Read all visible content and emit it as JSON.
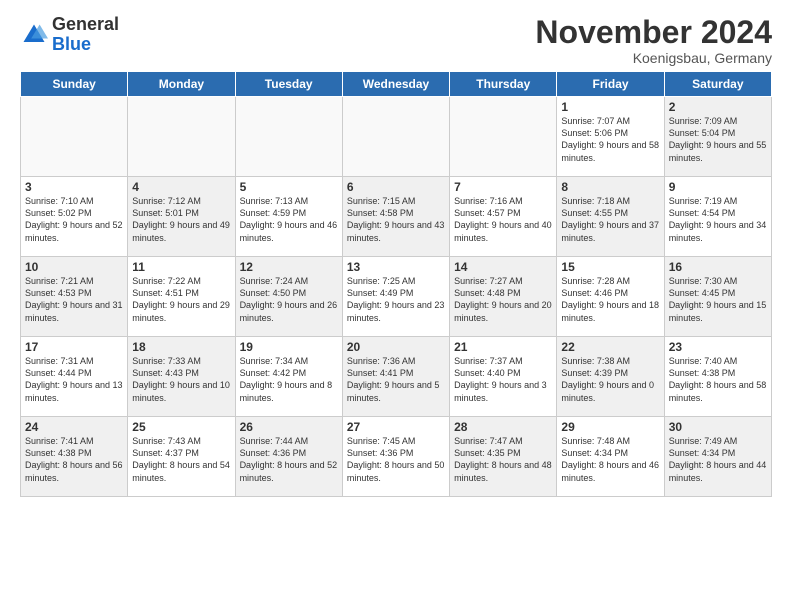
{
  "logo": {
    "general": "General",
    "blue": "Blue"
  },
  "header": {
    "title": "November 2024",
    "subtitle": "Koenigsbau, Germany"
  },
  "weekdays": [
    "Sunday",
    "Monday",
    "Tuesday",
    "Wednesday",
    "Thursday",
    "Friday",
    "Saturday"
  ],
  "weeks": [
    [
      {
        "day": "",
        "info": "",
        "empty": true
      },
      {
        "day": "",
        "info": "",
        "empty": true
      },
      {
        "day": "",
        "info": "",
        "empty": true
      },
      {
        "day": "",
        "info": "",
        "empty": true
      },
      {
        "day": "",
        "info": "",
        "empty": true
      },
      {
        "day": "1",
        "info": "Sunrise: 7:07 AM\nSunset: 5:06 PM\nDaylight: 9 hours\nand 58 minutes.",
        "empty": false
      },
      {
        "day": "2",
        "info": "Sunrise: 7:09 AM\nSunset: 5:04 PM\nDaylight: 9 hours\nand 55 minutes.",
        "empty": false
      }
    ],
    [
      {
        "day": "3",
        "info": "Sunrise: 7:10 AM\nSunset: 5:02 PM\nDaylight: 9 hours\nand 52 minutes.",
        "empty": false
      },
      {
        "day": "4",
        "info": "Sunrise: 7:12 AM\nSunset: 5:01 PM\nDaylight: 9 hours\nand 49 minutes.",
        "empty": false
      },
      {
        "day": "5",
        "info": "Sunrise: 7:13 AM\nSunset: 4:59 PM\nDaylight: 9 hours\nand 46 minutes.",
        "empty": false
      },
      {
        "day": "6",
        "info": "Sunrise: 7:15 AM\nSunset: 4:58 PM\nDaylight: 9 hours\nand 43 minutes.",
        "empty": false
      },
      {
        "day": "7",
        "info": "Sunrise: 7:16 AM\nSunset: 4:57 PM\nDaylight: 9 hours\nand 40 minutes.",
        "empty": false
      },
      {
        "day": "8",
        "info": "Sunrise: 7:18 AM\nSunset: 4:55 PM\nDaylight: 9 hours\nand 37 minutes.",
        "empty": false
      },
      {
        "day": "9",
        "info": "Sunrise: 7:19 AM\nSunset: 4:54 PM\nDaylight: 9 hours\nand 34 minutes.",
        "empty": false
      }
    ],
    [
      {
        "day": "10",
        "info": "Sunrise: 7:21 AM\nSunset: 4:53 PM\nDaylight: 9 hours\nand 31 minutes.",
        "empty": false
      },
      {
        "day": "11",
        "info": "Sunrise: 7:22 AM\nSunset: 4:51 PM\nDaylight: 9 hours\nand 29 minutes.",
        "empty": false
      },
      {
        "day": "12",
        "info": "Sunrise: 7:24 AM\nSunset: 4:50 PM\nDaylight: 9 hours\nand 26 minutes.",
        "empty": false
      },
      {
        "day": "13",
        "info": "Sunrise: 7:25 AM\nSunset: 4:49 PM\nDaylight: 9 hours\nand 23 minutes.",
        "empty": false
      },
      {
        "day": "14",
        "info": "Sunrise: 7:27 AM\nSunset: 4:48 PM\nDaylight: 9 hours\nand 20 minutes.",
        "empty": false
      },
      {
        "day": "15",
        "info": "Sunrise: 7:28 AM\nSunset: 4:46 PM\nDaylight: 9 hours\nand 18 minutes.",
        "empty": false
      },
      {
        "day": "16",
        "info": "Sunrise: 7:30 AM\nSunset: 4:45 PM\nDaylight: 9 hours\nand 15 minutes.",
        "empty": false
      }
    ],
    [
      {
        "day": "17",
        "info": "Sunrise: 7:31 AM\nSunset: 4:44 PM\nDaylight: 9 hours\nand 13 minutes.",
        "empty": false
      },
      {
        "day": "18",
        "info": "Sunrise: 7:33 AM\nSunset: 4:43 PM\nDaylight: 9 hours\nand 10 minutes.",
        "empty": false
      },
      {
        "day": "19",
        "info": "Sunrise: 7:34 AM\nSunset: 4:42 PM\nDaylight: 9 hours\nand 8 minutes.",
        "empty": false
      },
      {
        "day": "20",
        "info": "Sunrise: 7:36 AM\nSunset: 4:41 PM\nDaylight: 9 hours\nand 5 minutes.",
        "empty": false
      },
      {
        "day": "21",
        "info": "Sunrise: 7:37 AM\nSunset: 4:40 PM\nDaylight: 9 hours\nand 3 minutes.",
        "empty": false
      },
      {
        "day": "22",
        "info": "Sunrise: 7:38 AM\nSunset: 4:39 PM\nDaylight: 9 hours\nand 0 minutes.",
        "empty": false
      },
      {
        "day": "23",
        "info": "Sunrise: 7:40 AM\nSunset: 4:38 PM\nDaylight: 8 hours\nand 58 minutes.",
        "empty": false
      }
    ],
    [
      {
        "day": "24",
        "info": "Sunrise: 7:41 AM\nSunset: 4:38 PM\nDaylight: 8 hours\nand 56 minutes.",
        "empty": false
      },
      {
        "day": "25",
        "info": "Sunrise: 7:43 AM\nSunset: 4:37 PM\nDaylight: 8 hours\nand 54 minutes.",
        "empty": false
      },
      {
        "day": "26",
        "info": "Sunrise: 7:44 AM\nSunset: 4:36 PM\nDaylight: 8 hours\nand 52 minutes.",
        "empty": false
      },
      {
        "day": "27",
        "info": "Sunrise: 7:45 AM\nSunset: 4:36 PM\nDaylight: 8 hours\nand 50 minutes.",
        "empty": false
      },
      {
        "day": "28",
        "info": "Sunrise: 7:47 AM\nSunset: 4:35 PM\nDaylight: 8 hours\nand 48 minutes.",
        "empty": false
      },
      {
        "day": "29",
        "info": "Sunrise: 7:48 AM\nSunset: 4:34 PM\nDaylight: 8 hours\nand 46 minutes.",
        "empty": false
      },
      {
        "day": "30",
        "info": "Sunrise: 7:49 AM\nSunset: 4:34 PM\nDaylight: 8 hours\nand 44 minutes.",
        "empty": false
      }
    ]
  ]
}
